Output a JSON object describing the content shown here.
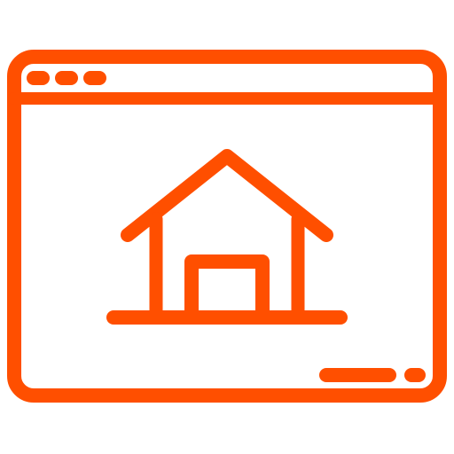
{
  "icon": {
    "name": "browser-window-home-icon",
    "stroke_color": "#FF4F00",
    "background_color": "#FFFFFF"
  },
  "window": {
    "title_bar_controls": [
      {
        "name": "window-dot-1"
      },
      {
        "name": "window-dot-2"
      },
      {
        "name": "window-dot-3"
      }
    ],
    "status_bar": [
      {
        "name": "status-bar-long"
      },
      {
        "name": "status-bar-short"
      }
    ]
  },
  "content": {
    "icon_name": "house-icon"
  }
}
